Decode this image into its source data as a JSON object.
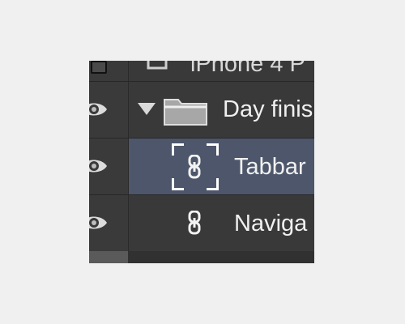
{
  "layers": {
    "top_partial": {
      "label": "iPhone 4 P"
    },
    "group": {
      "label": "Day finis",
      "expanded": true
    },
    "selected_layer": {
      "label": "Tabbar"
    },
    "next_layer": {
      "label": "Naviga"
    }
  },
  "icons": {
    "visibility": "eye-icon",
    "disclosure": "triangle-down-icon",
    "folder": "folder-icon",
    "link": "link-icon",
    "selection_frame": "selection-frame-icon"
  },
  "colors": {
    "panel_bg": "#393939",
    "selected_bg": "#4d566b",
    "divider": "#272727",
    "text": "#f0f0f0"
  }
}
